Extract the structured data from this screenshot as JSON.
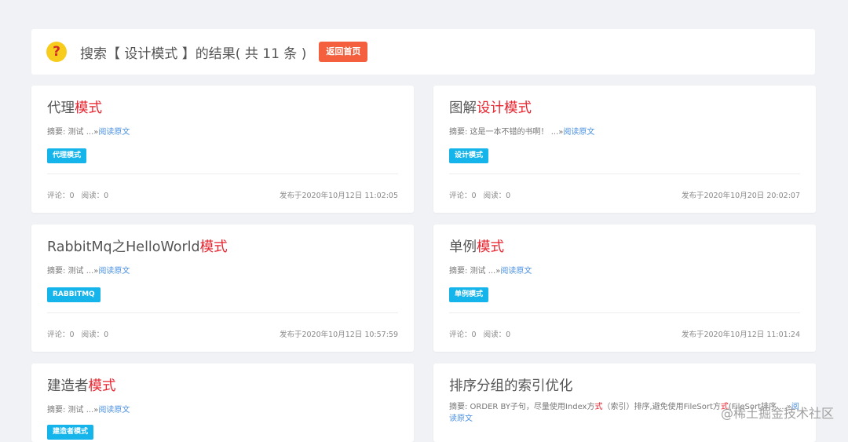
{
  "header": {
    "icon": "question-icon",
    "title_prefix": "搜索【 ",
    "query": "设计模式",
    "title_suffix": " 】的结果( 共 11 条 )",
    "back_button": "返回首页"
  },
  "cards": [
    {
      "title_plain": "代理",
      "title_highlight": "模式",
      "summary": "摘要: 测试 ...»",
      "read_more": "阅读原文",
      "tag": "代理模式",
      "stats": "评论：0   阅读：0",
      "date": "发布于2020年10月12日 11:02:05"
    },
    {
      "title_plain": "图解",
      "title_highlight": "设计模式",
      "summary": "摘要: 这是一本不错的书啊！ ...»",
      "read_more": "阅读原文",
      "tag": "设计模式",
      "stats": "评论：0   阅读：0",
      "date": "发布于2020年10月20日 20:02:07"
    },
    {
      "title_plain": "RabbitMq之HelloWorld",
      "title_highlight": "模式",
      "summary": "摘要: 测试 ...»",
      "read_more": "阅读原文",
      "tag": "RABBITMQ",
      "stats": "评论：0   阅读：0",
      "date": "发布于2020年10月12日 10:57:59"
    },
    {
      "title_plain": "单例",
      "title_highlight": "模式",
      "summary": "摘要: 测试 ...»",
      "read_more": "阅读原文",
      "tag": "单例模式",
      "stats": "评论：0   阅读：0",
      "date": "发布于2020年10月12日 11:01:24"
    },
    {
      "title_plain": "建造者",
      "title_highlight": "模式",
      "summary": "摘要: 测试 ...»",
      "read_more": "阅读原文",
      "tag": "建造者模式"
    },
    {
      "title_plain": "排序分组的索引优化",
      "summary_long_prefix": "摘要: ORDER BY子句，尽量使用Index方",
      "summary_long_hl": "式",
      "summary_long_mid": "（索引）排序,避免使用FileSort方",
      "summary_long_hl2": "式",
      "summary_long_suffix": "(FileSort排序 ...»",
      "read_more": "阅读原文"
    }
  ],
  "watermark": "@稀土掘金技术社区",
  "colors": {
    "background": "#f0f2f5",
    "highlight": "#e9232e",
    "tag": "#15b5eb",
    "back_button": "#f4603d",
    "link": "#4a90e2"
  }
}
